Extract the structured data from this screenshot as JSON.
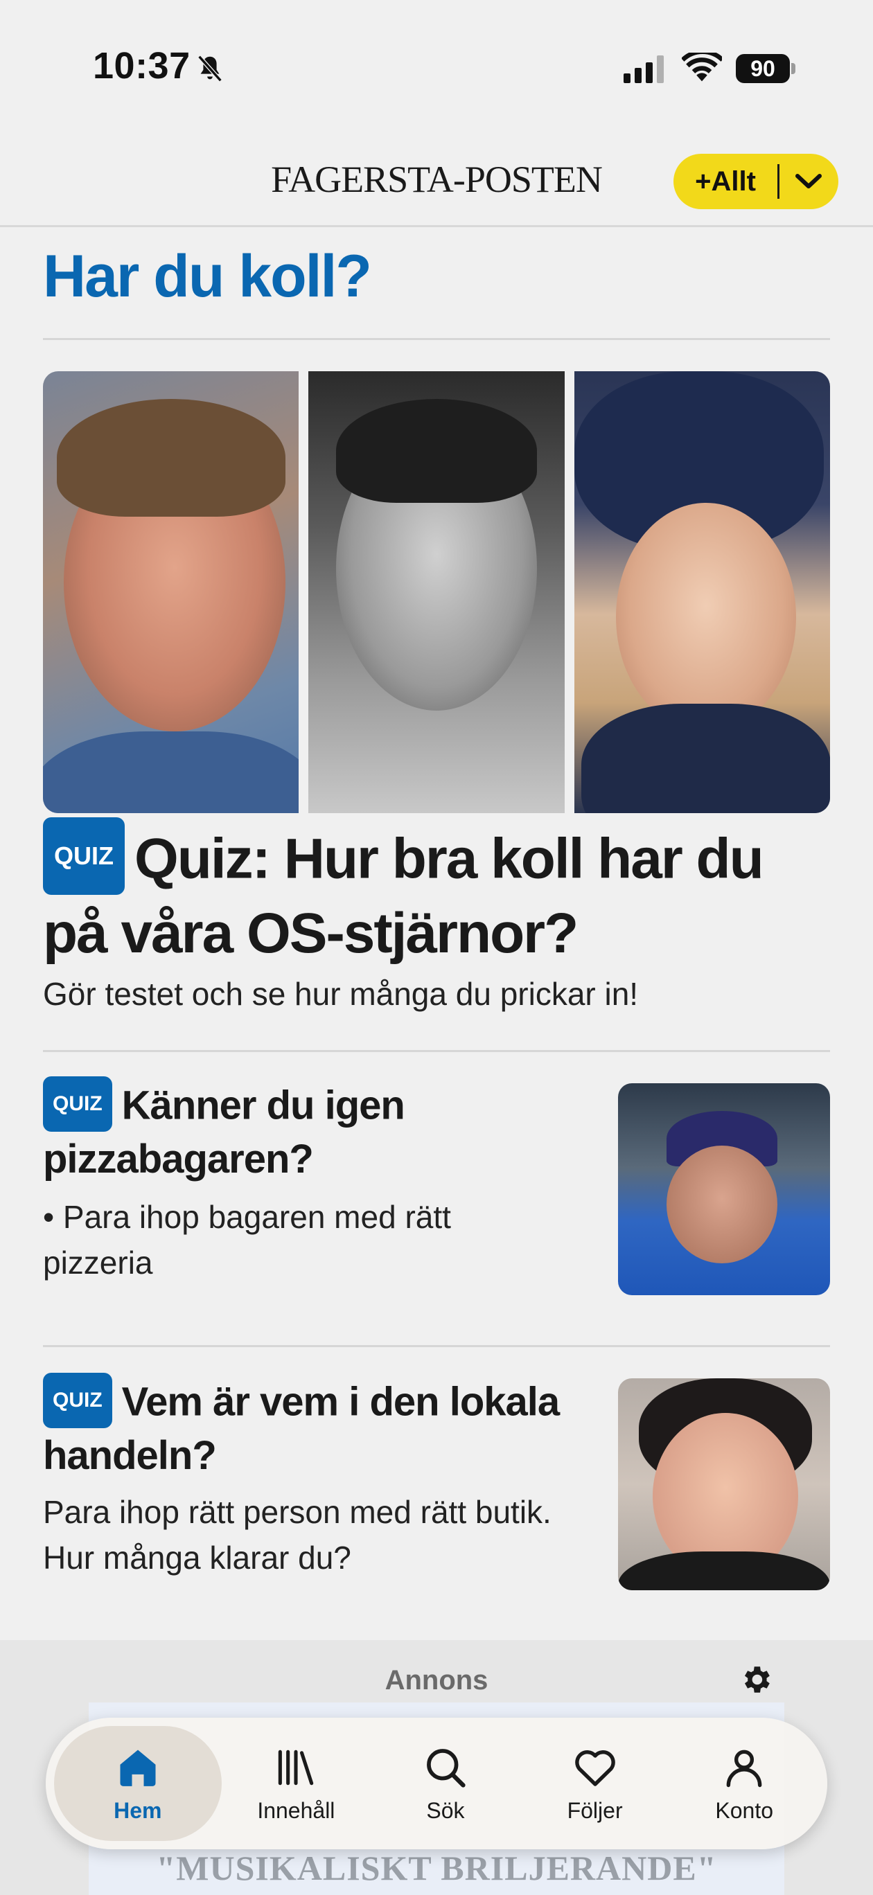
{
  "status_bar": {
    "time": "10:37",
    "battery": "90"
  },
  "header": {
    "brand": "FAGERSTA-POSTEN",
    "plus_button": "+Allt"
  },
  "section": {
    "title": "Har du koll?"
  },
  "articles": [
    {
      "badge": "QUIZ",
      "headline": "Quiz: Hur bra koll har du på våra OS-stjärnor?",
      "lead": "Gör testet och se hur många du prickar in!"
    },
    {
      "badge": "QUIZ",
      "headline": "Känner du igen pizzabagaren?",
      "lead": "• Para ihop bagaren med rätt pizzeria"
    },
    {
      "badge": "QUIZ",
      "headline": "Vem är vem i den lokala handeln?",
      "lead": "Para ihop rätt person med rätt butik. Hur många klarar du?"
    }
  ],
  "ad": {
    "label": "Annons",
    "creative_text": "\"MUSIKALISKT BRILJERANDE\""
  },
  "bottom_nav": [
    {
      "label": "Hem",
      "icon": "home-icon",
      "active": true
    },
    {
      "label": "Innehåll",
      "icon": "library-icon"
    },
    {
      "label": "Sök",
      "icon": "search-icon"
    },
    {
      "label": "Följer",
      "icon": "heart-icon"
    },
    {
      "label": "Konto",
      "icon": "person-icon"
    }
  ],
  "colors": {
    "accent": "#0a67b1",
    "button_yellow": "#f2d91a",
    "background": "#f0f0f0"
  }
}
